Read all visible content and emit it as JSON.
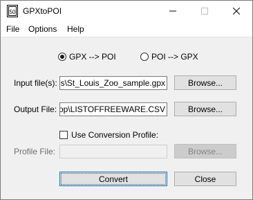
{
  "window": {
    "title": "GPXtoPOI",
    "icon_text": "50"
  },
  "menu": {
    "items": [
      "File",
      "Options",
      "Help"
    ]
  },
  "mode": {
    "option1": "GPX --> POI",
    "option2": "POI --> GPX",
    "selected": "GPX --> POI"
  },
  "input": {
    "label": "Input file(s):",
    "value": "oads\\St_Louis_Zoo_sample.gpx",
    "browse_label": "Browse..."
  },
  "output": {
    "label": "Output File:",
    "value": "sktop\\LISTOFFREEWARE.CSV",
    "browse_label": "Browse..."
  },
  "profile": {
    "checkbox_label": "Use Conversion Profile:",
    "checked": false,
    "label": "Profile File:",
    "value": "",
    "browse_label": "Browse..."
  },
  "actions": {
    "convert_label": "Convert",
    "close_label": "Close"
  }
}
